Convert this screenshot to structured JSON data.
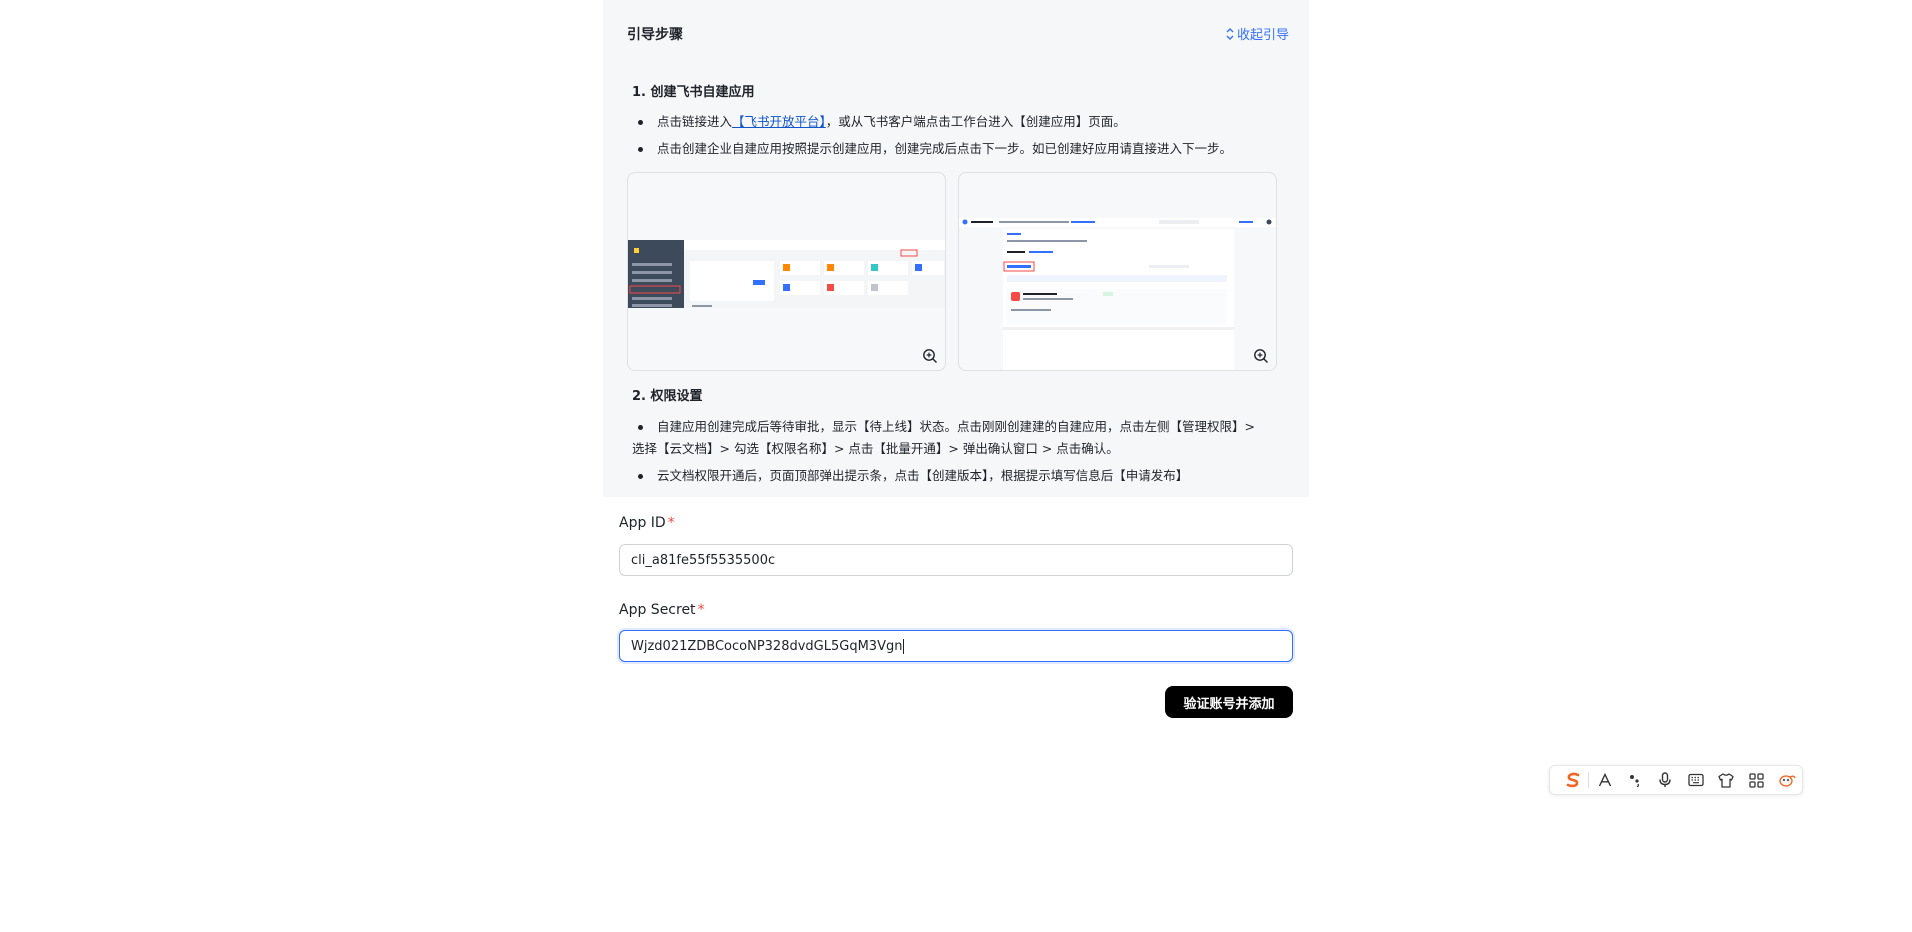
{
  "guide": {
    "title": "引导步骤",
    "collapse_label": "收起引导",
    "step1": {
      "title": "1. 创建飞书自建应用",
      "bullet1_pre": "点击链接进入",
      "bullet1_link": "【飞书开放平台】",
      "bullet1_post": "，或从飞书客户端点击工作台进入【创建应用】页面。",
      "bullet2": "点击创建企业自建应用按照提示创建应用，创建完成后点击下一步。如已创建好应用请直接进入下一步。"
    },
    "step2": {
      "title": "2. 权限设置",
      "bullet1_line1": "自建应用创建完成后等待审批，显示【待上线】状态。点击刚刚创建建的自建应用，点击左侧【管理权限】>",
      "bullet1_line2": "选择【云文档】> 勾选【权限名称】> 点击【批量开通】> 弹出确认窗口 > 点击确认。",
      "bullet2_partial": "云文档权限开通后，页面顶部弹出提示条，点击【创建版本】，根据提示填写信息后【申请发布】"
    }
  },
  "form": {
    "app_id_label": "App ID",
    "app_id_value": "cli_a81fe55f5535500c",
    "app_secret_label": "App Secret",
    "app_secret_value": "Wjzd021ZDBCocoNP328dvdGL5GqM3Vgn",
    "required_mark": "*",
    "submit_label": "验证账号并添加"
  },
  "ime_toolbar": {
    "logo_icon": "sogou-s-icon",
    "items": [
      "font-icon",
      "punctuation-icon",
      "mic-icon",
      "keyboard-icon",
      "skin-icon",
      "grid-icon",
      "mascot-icon"
    ]
  }
}
